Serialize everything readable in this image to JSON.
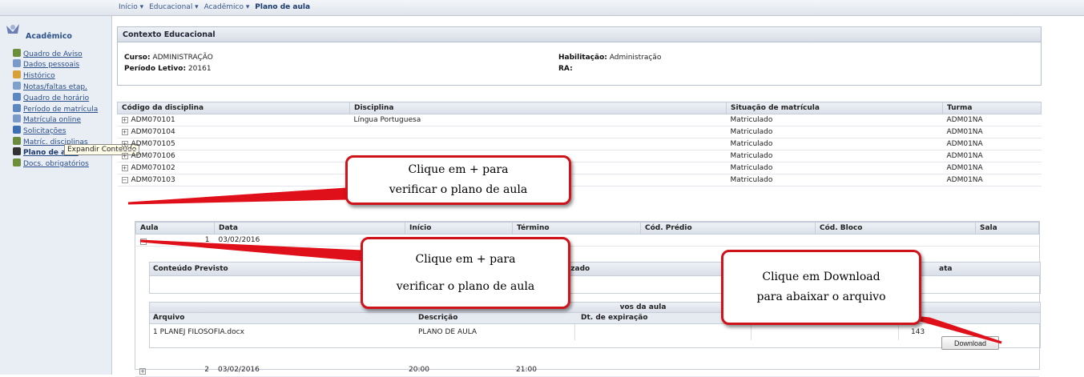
{
  "breadcrumb": [
    "Início ▾",
    "Educacional ▾",
    "Acadêmico ▾",
    "Plano de aula"
  ],
  "sidebar": {
    "title": "Acadêmico",
    "items": [
      {
        "label": "Quadro de Aviso",
        "icon": "notice-icon",
        "color": "#6d8f3b"
      },
      {
        "label": "Dados pessoais",
        "icon": "person-icon",
        "color": "#7a9bc8"
      },
      {
        "label": "Histórico",
        "icon": "history-icon",
        "color": "#d7a13a"
      },
      {
        "label": "Notas/faltas etap.",
        "icon": "grades-icon",
        "color": "#7fa0c9"
      },
      {
        "label": "Quadro de horário",
        "icon": "clock-icon",
        "color": "#5b86c0"
      },
      {
        "label": "Período de matrícula",
        "icon": "calendar-icon",
        "color": "#5b86c0"
      },
      {
        "label": "Matrícula online",
        "icon": "enroll-icon",
        "color": "#7a9bc8"
      },
      {
        "label": "Solicitações",
        "icon": "request-icon",
        "color": "#3f6fb3"
      },
      {
        "label": "Matríc. disciplinas",
        "icon": "check-icon",
        "color": "#6a8a3e"
      },
      {
        "label": "Plano de aula",
        "icon": "lesson-plan-icon",
        "color": "#333333"
      },
      {
        "label": "Docs. obrigatórios",
        "icon": "document-icon",
        "color": "#6d8f3b"
      }
    ],
    "tooltip": "Expandir Conteúdo"
  },
  "context": {
    "title": "Contexto Educacional",
    "curso_label": "Curso:",
    "curso": "ADMINISTRAÇÃO",
    "periodo_label": "Período Letivo:",
    "periodo": "20161",
    "habilitacao_label": "Habilitação:",
    "habilitacao": "Administração",
    "ra_label": "RA:",
    "ra": ""
  },
  "disciplines": {
    "headers": [
      "Código da disciplina",
      "Disciplina",
      "Situação de matrícula",
      "Turma"
    ],
    "rows": [
      {
        "code": "ADM070101",
        "name": "Língua Portuguesa",
        "status": "Matriculado",
        "turma": "ADM01NA"
      },
      {
        "code": "ADM070104",
        "name": "",
        "status": "Matriculado",
        "turma": "ADM01NA"
      },
      {
        "code": "ADM070105",
        "name": "",
        "status": "Matriculado",
        "turma": "ADM01NA"
      },
      {
        "code": "ADM070106",
        "name": "",
        "status": "Matriculado",
        "turma": "ADM01NA"
      },
      {
        "code": "ADM070102",
        "name": "",
        "status": "Matriculado",
        "turma": "ADM01NA"
      },
      {
        "code": "ADM070103",
        "name": "",
        "status": "Matriculado",
        "turma": "ADM01NA"
      }
    ]
  },
  "lessons": {
    "headers": [
      "Aula",
      "Data",
      "Início",
      "Término",
      "Cód. Prédio",
      "Cód. Bloco",
      "Sala"
    ],
    "rows": [
      {
        "aula": "1",
        "data": "03/02/2016",
        "inicio": "",
        "termino": ""
      },
      {
        "aula": "2",
        "data": "03/02/2016",
        "inicio": "20:00",
        "termino": "21:00"
      }
    ]
  },
  "content": {
    "previsto": "Conteúdo Previsto",
    "realizado": "Realizado",
    "data_label": "ata"
  },
  "files": {
    "section_title": "vos da aula",
    "headers": [
      "Arquivo",
      "Descrição",
      "Dt. de expiração"
    ],
    "row": {
      "arquivo": "1 PLANEJ FILOSOFIA.docx",
      "descricao": "PLANO DE AULA",
      "expiracao": "",
      "size": "143"
    },
    "download_label": "Download"
  },
  "callouts": {
    "top": [
      "Clique em + para",
      "verificar o plano de aula"
    ],
    "middle": [
      "Clique em + para",
      "verificar o plano de aula"
    ],
    "right": [
      "Clique em Download",
      "para abaixar o arquivo"
    ]
  },
  "colors": {
    "callout_border": "#d0121b",
    "pointer": "#e0101a",
    "link": "#2a4f8a"
  }
}
